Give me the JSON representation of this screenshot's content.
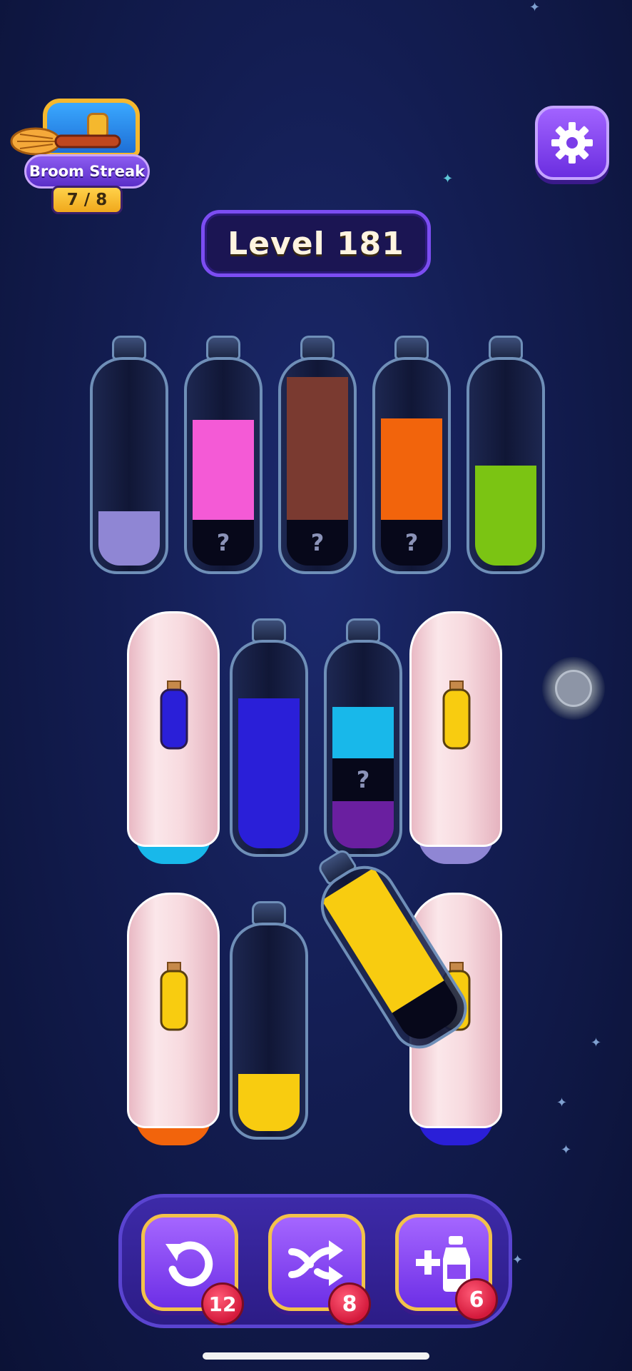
{
  "streak": {
    "label": "Broom Streak",
    "count": "7 / 8"
  },
  "level": {
    "label": "Level 181"
  },
  "colors": {
    "lavender": "#8f86d4",
    "pink": "#f45ad6",
    "brown": "#7a3a30",
    "orange": "#f2640c",
    "lime": "#7bc413",
    "blue": "#2a1fd8",
    "cyan": "#18b8ea",
    "purple": "#6a1fa0",
    "yellow": "#f8cc10",
    "hidden": "#07081a"
  },
  "bottles_row1": [
    {
      "layers": [
        "lavender"
      ],
      "hidden": 0
    },
    {
      "layers": [
        "pink"
      ],
      "hidden": 1,
      "hidden_mark": "?"
    },
    {
      "layers": [
        "brown"
      ],
      "hidden": 1,
      "hidden_mark": "?"
    },
    {
      "layers": [
        "orange"
      ],
      "hidden": 1,
      "hidden_mark": "?"
    },
    {
      "layers": [
        "lime"
      ],
      "hidden": 0
    }
  ],
  "bottles_row2": [
    {
      "covered": true,
      "hint_color": "blue",
      "base_color": "cyan"
    },
    {
      "layers": [
        "blue"
      ],
      "hidden": 0
    },
    {
      "layers": [
        "cyan",
        "hidden",
        "purple"
      ],
      "hidden_mark": "?"
    },
    {
      "covered": true,
      "hint_color": "yellow",
      "base_color": "lavender"
    }
  ],
  "bottles_row3": [
    {
      "covered": true,
      "hint_color": "yellow",
      "base_color": "orange"
    },
    {
      "layers": [
        "yellow"
      ],
      "hidden": 0
    },
    {
      "tilted": true,
      "layers": [
        "yellow"
      ],
      "hidden": 1
    },
    {
      "covered": true,
      "hint_color": "yellow",
      "base_color": "blue"
    }
  ],
  "powerups": [
    {
      "name": "undo",
      "icon": "undo-icon",
      "count": "12"
    },
    {
      "name": "shuffle",
      "icon": "shuffle-icon",
      "count": "8"
    },
    {
      "name": "add-bottle",
      "icon": "add-bottle-icon",
      "count": "6"
    }
  ]
}
